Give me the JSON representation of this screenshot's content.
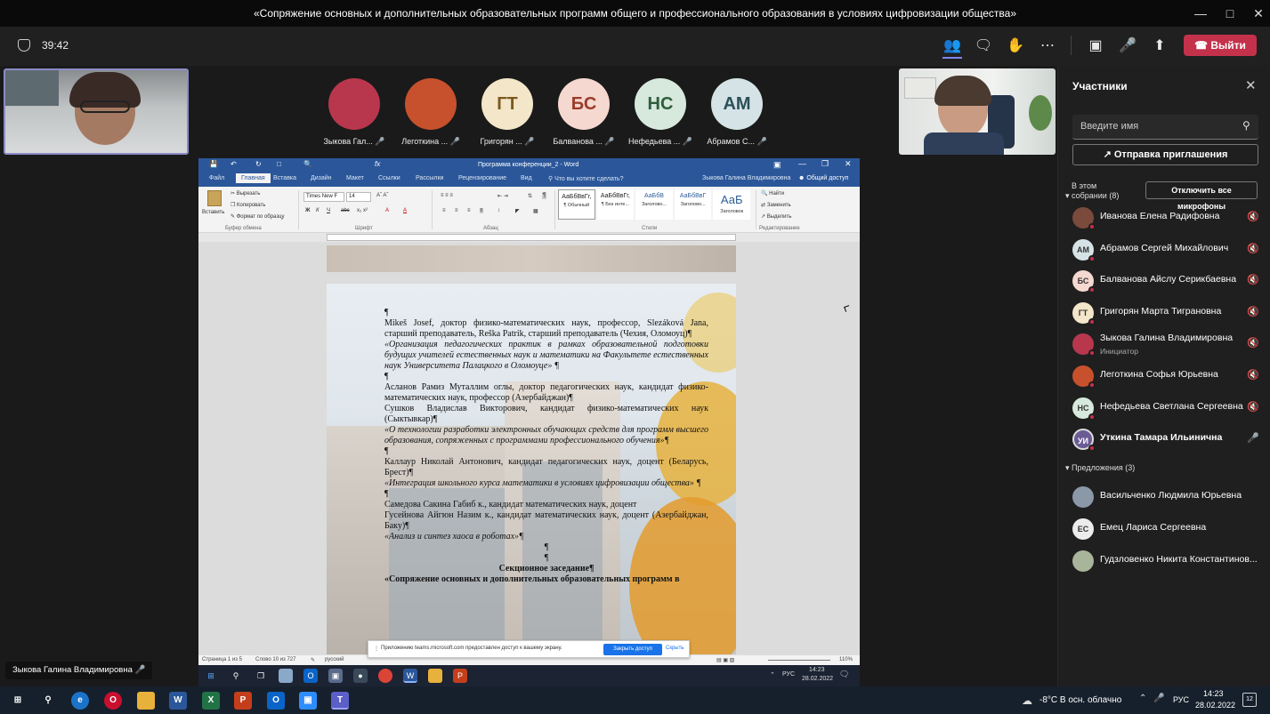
{
  "window": {
    "title": "«Сопряжение основных и дополнительных образовательных программ общего и профессионального образования в условиях цифровизации общества»"
  },
  "meeting": {
    "timer": "39:42",
    "leave_label": "Выйти"
  },
  "self_video": {
    "name": "Зыкова Галина Владимировна"
  },
  "avatars": [
    {
      "initials": "",
      "name": "Зыкова Гал...",
      "bg": "#b8374d"
    },
    {
      "initials": "",
      "name": "Леготкина ...",
      "bg": "#c7502d"
    },
    {
      "initials": "ГТ",
      "name": "Григорян ...",
      "bg": "#f3e6c9",
      "fg": "#7a5a1c"
    },
    {
      "initials": "БС",
      "name": "Балванова ...",
      "bg": "#f5d8cf",
      "fg": "#9b3b2b"
    },
    {
      "initials": "НС",
      "name": "Нефедьева ...",
      "bg": "#d7e8dc",
      "fg": "#2f5e3d"
    },
    {
      "initials": "АМ",
      "name": "Абрамов С...",
      "bg": "#d5e3e6",
      "fg": "#2b5059"
    }
  ],
  "word": {
    "title": "Программа конференции_2 - Word",
    "user": "Зыкова Галина Владимировна",
    "share_label": "Общий доступ",
    "tabs": [
      "Файл",
      "Главная",
      "Вставка",
      "Дизайн",
      "Макет",
      "Ссылки",
      "Рассылки",
      "Рецензирование",
      "Вид"
    ],
    "tell_me": "Что вы хотите сделать?",
    "clipboard": {
      "paste": "Вставить",
      "cut": "Вырезать",
      "copy": "Копировать",
      "format": "Формат по образцу",
      "group": "Буфер обмена"
    },
    "font": {
      "name": "Times New F",
      "size": "14",
      "group": "Шрифт"
    },
    "paragraph_group": "Абзац",
    "styles": [
      {
        "preview": "АаБбВвГг,",
        "label": "¶ Обычный"
      },
      {
        "preview": "АаБбВвГг,",
        "label": "¶ Без инте..."
      },
      {
        "preview": "АаБбВ",
        "label": "Заголово..."
      },
      {
        "preview": "АаБбВвГ",
        "label": "Заголово..."
      },
      {
        "preview": "АаБ",
        "label": "Заголовок"
      }
    ],
    "styles_group": "Стили",
    "editing": {
      "find": "Найти",
      "replace": "Заменить",
      "select": "Выделить",
      "group": "Редактирование"
    },
    "document": [
      {
        "t": "¶",
        "cls": ""
      },
      {
        "t": "Mikeš Josef, доктор физико-математических наук, профессор, Slezáková Jana, старший преподаватель, Reška Patrik, старший преподаватель (Чехия, Оломоуц)¶",
        "cls": ""
      },
      {
        "t": "«Организация педагогических практик в рамках образовательной подготовки будущих учителей естественных наук и математики на Факультете естественных наук Университета Палацкого в Оломоуце» ¶",
        "cls": "it"
      },
      {
        "t": "¶",
        "cls": ""
      },
      {
        "t": "Асланов Рамиз Муталлим оглы, доктор педагогических наук, кандидат физико-математических наук, профессор (Азербайджан)¶",
        "cls": ""
      },
      {
        "t": "Сушков Владислав Викторович, кандидат физико-математических наук (Сыктывкар)¶",
        "cls": ""
      },
      {
        "t": "«О технологии разработки электронных обучающих средств для программ высшего образования, сопряженных с программами профессионального обучения»¶",
        "cls": "it"
      },
      {
        "t": "¶",
        "cls": ""
      },
      {
        "t": "Каллаур Николай Антонович, кандидат педагогических наук, доцент (Беларусь, Брест)¶",
        "cls": ""
      },
      {
        "t": "«Интеграция школьного курса математики в условиях цифровизации общества» ¶",
        "cls": "it"
      },
      {
        "t": "¶",
        "cls": ""
      },
      {
        "t": "Самедова Сакина Габиб к., кандидат математических наук, доцент",
        "cls": ""
      },
      {
        "t": "Гусейнова Айгюн Назим к., кандидат математических наук, доцент (Азербайджан, Баку)¶",
        "cls": ""
      },
      {
        "t": "«Анализ и синтез хаоса в роботах»¶",
        "cls": "it"
      },
      {
        "t": "¶",
        "cls": "c"
      },
      {
        "t": "¶",
        "cls": "c"
      },
      {
        "t": "Секционное заседание¶",
        "cls": "c"
      },
      {
        "t": "«Сопряжение основных и дополнительных образовательных программ в",
        "cls": ""
      }
    ],
    "status": {
      "page": "Страница 1 из 5",
      "words": "Слово 10 из 727",
      "lang": "русский",
      "zoom": "110%"
    },
    "share_notice": "Приложению teams.microsoft.com предоставлен доступ к вашему экрану.",
    "share_stop": "Закрыть доступ",
    "share_hide": "Скрыть",
    "inner_clock": {
      "time": "14:23",
      "date": "28.02.2022",
      "lang": "РУС"
    }
  },
  "panel": {
    "title": "Участники",
    "search_placeholder": "Введите имя",
    "invite_label": "Отправка приглашения",
    "in_meeting": "В этом собрании (8)",
    "mute_all": "Отключить все микрофоны",
    "participants": [
      {
        "name": "Иванова Елена Радифовна",
        "initials": "",
        "bg": "#7a4a3c",
        "sub": "",
        "mic": "muted"
      },
      {
        "name": "Абрамов Сергей Михайлович",
        "initials": "АМ",
        "bg": "#d5e3e6",
        "sub": "",
        "mic": "muted"
      },
      {
        "name": "Балванова Айслу Серикбаевна",
        "initials": "БС",
        "bg": "#f5d8cf",
        "sub": "",
        "mic": "muted"
      },
      {
        "name": "Григорян Марта Тиграновна",
        "initials": "ГТ",
        "bg": "#f3e6c9",
        "sub": "",
        "mic": "muted"
      },
      {
        "name": "Зыкова Галина Владимировна",
        "initials": "",
        "bg": "#b8374d",
        "sub": "Инициатор",
        "mic": "muted"
      },
      {
        "name": "Леготкина Софья Юрьевна",
        "initials": "",
        "bg": "#c7502d",
        "sub": "",
        "mic": "muted"
      },
      {
        "name": "Нефедьева Светлана Сергеевна",
        "initials": "НС",
        "bg": "#d7e8dc",
        "sub": "",
        "mic": "muted"
      },
      {
        "name": "Уткина Тамара Ильинична",
        "initials": "УИ",
        "bg": "#e8e0f0",
        "sub": "",
        "mic": "on"
      }
    ],
    "suggestions": "Предложения (3)",
    "suggested": [
      {
        "name": "Васильченко Людмила Юрьевна",
        "initials": "",
        "bg": "#8a98a8"
      },
      {
        "name": "Емец Лариса Сергеевна",
        "initials": "ЕС",
        "bg": "#ececec"
      },
      {
        "name": "Гудзловенко Никита Константинов...",
        "initials": "",
        "bg": "#a8b59a"
      }
    ]
  },
  "taskbar": {
    "weather": "-8°C  В осн. облачно",
    "lang": "РУС",
    "time": "14:23",
    "date": "28.02.2022",
    "notif_count": "12"
  }
}
